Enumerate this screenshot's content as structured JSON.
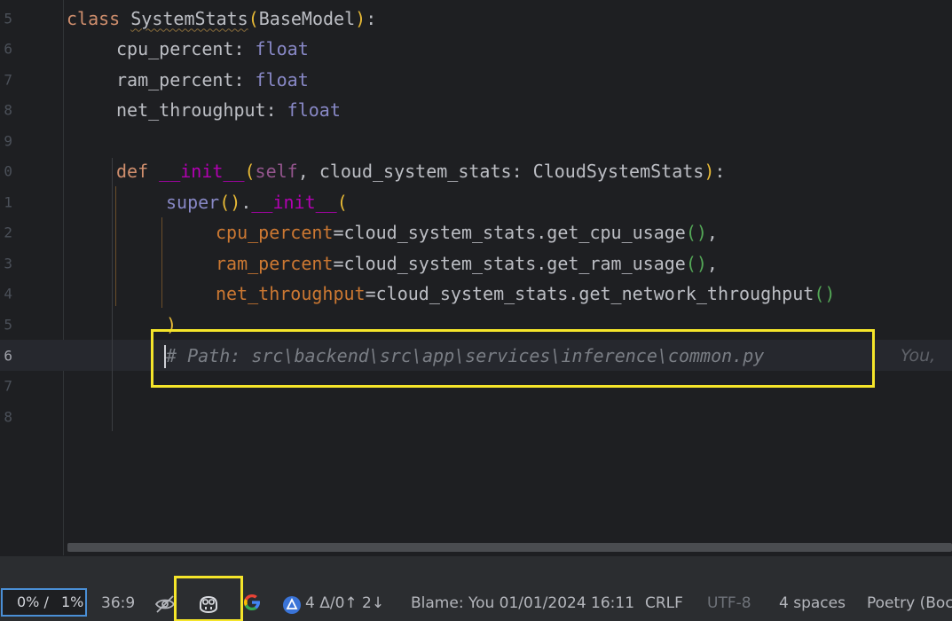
{
  "editor": {
    "lines": [
      {
        "num": "5",
        "kind": "class"
      },
      {
        "num": "6",
        "kind": "field1"
      },
      {
        "num": "7",
        "kind": "field2"
      },
      {
        "num": "8",
        "kind": "field3"
      },
      {
        "num": "9",
        "kind": "blank"
      },
      {
        "num": "0",
        "kind": "def"
      },
      {
        "num": "1",
        "kind": "super"
      },
      {
        "num": "2",
        "kind": "arg1"
      },
      {
        "num": "3",
        "kind": "arg2"
      },
      {
        "num": "4",
        "kind": "arg3"
      },
      {
        "num": "5",
        "kind": "close"
      },
      {
        "num": "6",
        "kind": "comment"
      },
      {
        "num": "7",
        "kind": "blank"
      },
      {
        "num": "8",
        "kind": "blank"
      }
    ],
    "tokens": {
      "class_kw": "class",
      "class_name": "SystemStats",
      "base": "BaseModel",
      "field_cpu": "cpu_percent",
      "field_ram": "ram_percent",
      "field_net": "net_throughput",
      "float": "float",
      "def_kw": "def",
      "init": "__init__",
      "self": "self",
      "param": "cloud_system_stats",
      "param_type": "CloudSystemStats",
      "super": "super",
      "call_cpu": "cloud_system_stats.get_cpu_usage",
      "call_ram": "cloud_system_stats.get_ram_usage",
      "call_net": "cloud_system_stats.get_network_throughput",
      "comment": "# Path: src\\backend\\src\\app\\services\\inference\\common.py"
    },
    "inlay_blame": "You,"
  },
  "statusbar": {
    "progress_left": "0% /",
    "progress_right": "1%",
    "cursor_position": "36:9",
    "vcs_summary": "4 Δ/0↑ 2↓",
    "blame": "Blame: You 01/01/2024 16:11",
    "line_ending": "CRLF",
    "encoding": "UTF-8",
    "indent": "4 spaces",
    "interpreter": "Poetry (Boc"
  },
  "colors": {
    "highlight": "#f5e52a",
    "keyword": "#cf8e6d",
    "type": "#8888c6",
    "comment": "#7a7e85"
  }
}
